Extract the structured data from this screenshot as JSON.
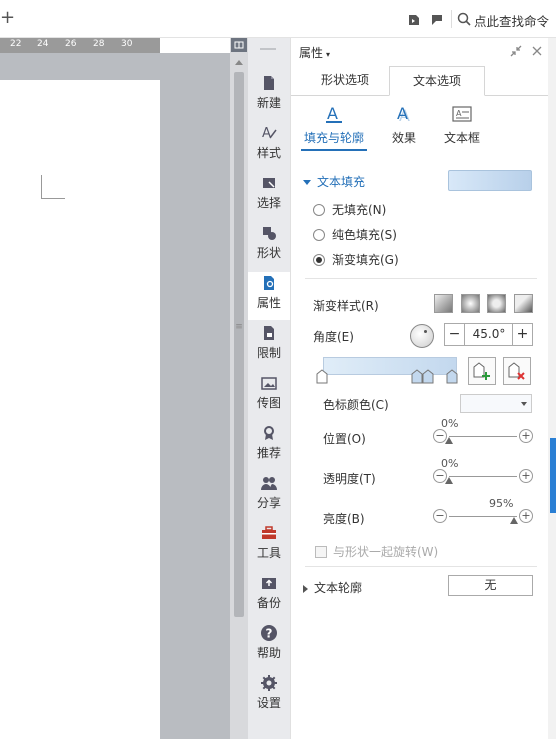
{
  "toolbar": {
    "plus_glyph": "+",
    "search_label": "点此查找命令"
  },
  "ruler": {
    "ticks": [
      "22",
      "24",
      "26",
      "28",
      "30"
    ]
  },
  "dock": {
    "items": [
      {
        "label": "新建",
        "icon": "new-doc-icon"
      },
      {
        "label": "样式",
        "icon": "style-icon"
      },
      {
        "label": "选择",
        "icon": "select-icon"
      },
      {
        "label": "形状",
        "icon": "shape-icon"
      },
      {
        "label": "属性",
        "icon": "properties-icon",
        "active": true
      },
      {
        "label": "限制",
        "icon": "restrict-icon"
      },
      {
        "label": "传图",
        "icon": "upload-image-icon"
      },
      {
        "label": "推荐",
        "icon": "recommend-icon"
      },
      {
        "label": "分享",
        "icon": "share-icon"
      },
      {
        "label": "工具",
        "icon": "toolbox-icon"
      },
      {
        "label": "备份",
        "icon": "backup-icon"
      },
      {
        "label": "帮助",
        "icon": "help-icon"
      },
      {
        "label": "设置",
        "icon": "settings-icon"
      }
    ]
  },
  "panel": {
    "title": "属性",
    "caret": "▾",
    "tabs": [
      {
        "label": "形状选项"
      },
      {
        "label": "文本选项",
        "active": true
      }
    ],
    "subtabs": [
      {
        "label": "填充与轮廓",
        "active": true
      },
      {
        "label": "效果"
      },
      {
        "label": "文本框"
      }
    ],
    "text_fill": {
      "header": "文本填充",
      "options": [
        {
          "label": "无填充(N)",
          "selected": false
        },
        {
          "label": "纯色填充(S)",
          "selected": false
        },
        {
          "label": "渐变填充(G)",
          "selected": true
        }
      ]
    },
    "gradient": {
      "style_label": "渐变样式(R)",
      "angle_label": "角度(E)",
      "angle_value": "45.0°",
      "minus": "−",
      "plus": "+",
      "stop_color_label": "色标颜色(C)",
      "position_label": "位置(O)",
      "position_value": "0%",
      "position_fraction": 0.0,
      "transparency_label": "透明度(T)",
      "transparency_value": "0%",
      "transparency_fraction": 0.0,
      "brightness_label": "亮度(B)",
      "brightness_value": "95%",
      "brightness_fraction": 0.95,
      "slider_minus": "−",
      "slider_plus": "+",
      "rotate_label": "与形状一起旋转(W)"
    },
    "text_outline": {
      "header": "文本轮廓",
      "value": "无"
    }
  },
  "colors": {
    "accent": "#2470b8",
    "dock_bg": "#e9eaed",
    "doc_bg": "#b9bcc1",
    "thumb": "#b3b5b9"
  }
}
